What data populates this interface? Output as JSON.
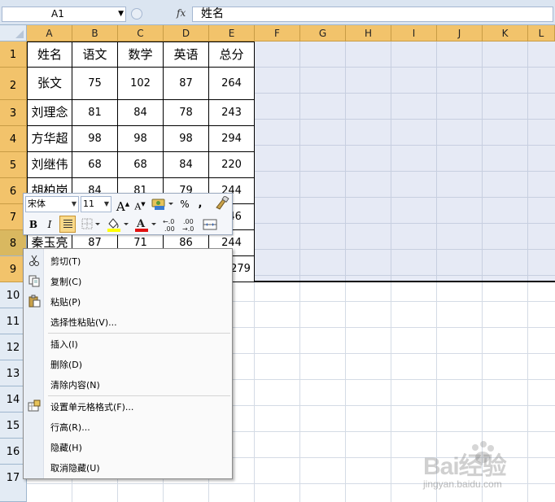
{
  "formula_bar": {
    "name_box": "A1",
    "fx_label": "fx",
    "formula_value": "姓名"
  },
  "columns": [
    "A",
    "B",
    "C",
    "D",
    "E",
    "F",
    "G",
    "H",
    "I",
    "J",
    "K",
    "L"
  ],
  "rows": [
    "1",
    "2",
    "3",
    "4",
    "5",
    "6",
    "7",
    "8",
    "9",
    "10",
    "11",
    "12",
    "13",
    "14",
    "15",
    "16",
    "17"
  ],
  "table": {
    "header": [
      "姓名",
      "语文",
      "数学",
      "英语",
      "总分"
    ],
    "rows": [
      [
        "张文",
        "75",
        "102",
        "87",
        "264"
      ],
      [
        "刘理念",
        "81",
        "84",
        "78",
        "243"
      ],
      [
        "方华超",
        "98",
        "98",
        "98",
        "294"
      ],
      [
        "刘继伟",
        "68",
        "68",
        "84",
        "220"
      ],
      [
        "胡柏岗",
        "84",
        "81",
        "79",
        "244"
      ],
      [
        "",
        "",
        "",
        "",
        "246"
      ],
      [
        "秦玉亮",
        "87",
        "71",
        "86",
        "244"
      ],
      [
        "",
        "",
        "",
        "",
        "279"
      ]
    ]
  },
  "mini_toolbar": {
    "font_name": "宋体",
    "font_size": "11",
    "grow_font": "A",
    "shrink_font": "A",
    "percent": "%",
    "comma": ",",
    "bold": "B",
    "italic": "I",
    "font_color_letter": "A",
    "increase_decimal": "+.0\n.00",
    "decrease_decimal": ".00\n+.0"
  },
  "context_menu": {
    "items": [
      {
        "label": "剪切(T)",
        "icon": "scissors-icon"
      },
      {
        "label": "复制(C)",
        "icon": "copy-icon"
      },
      {
        "label": "粘贴(P)",
        "icon": "paste-icon"
      },
      {
        "label": "选择性粘贴(V)...",
        "icon": ""
      },
      {
        "label": "插入(I)",
        "icon": ""
      },
      {
        "label": "删除(D)",
        "icon": ""
      },
      {
        "label": "清除内容(N)",
        "icon": ""
      },
      {
        "label": "设置单元格格式(F)...",
        "icon": "format-cells-icon"
      },
      {
        "label": "行高(R)...",
        "icon": ""
      },
      {
        "label": "隐藏(H)",
        "icon": ""
      },
      {
        "label": "取消隐藏(U)",
        "icon": ""
      }
    ]
  },
  "watermark": {
    "brand": "Bai经验",
    "url": "jingyan.baidu.com"
  },
  "colors": {
    "header_selected": "#f2c36b",
    "header_normal": "#e3ebf4",
    "selection_fill": "#e6eaf5",
    "toolbar_active": "#f9d98a",
    "font_color_bar": "#e01010",
    "fill_color_bar": "#ffff00"
  }
}
